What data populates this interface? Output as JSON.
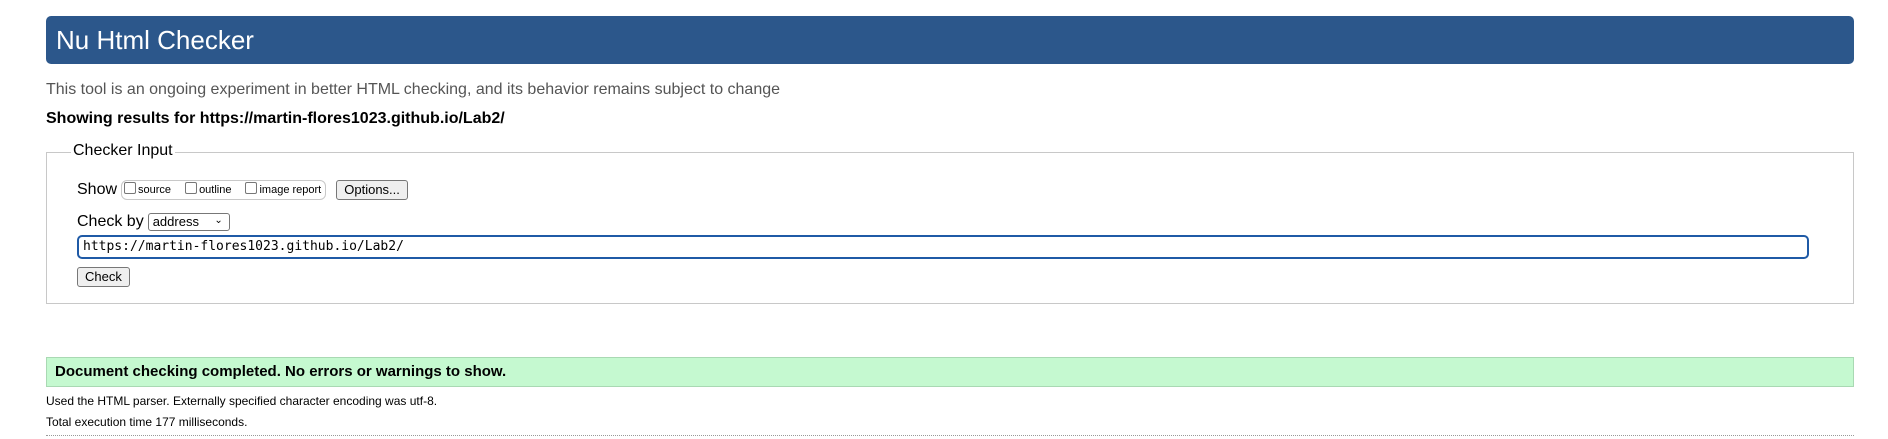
{
  "header": {
    "title": "Nu Html Checker"
  },
  "intro": "This tool is an ongoing experiment in better HTML checking, and its behavior remains subject to change",
  "results_for": "Showing results for https://martin-flores1023.github.io/Lab2/",
  "checker_input": {
    "legend": "Checker Input",
    "show_label": "Show",
    "checkboxes": [
      {
        "label": "source",
        "checked": false
      },
      {
        "label": "outline",
        "checked": false
      },
      {
        "label": "image report",
        "checked": false
      }
    ],
    "options_button": "Options...",
    "check_by_label": "Check by",
    "check_by_selected": "address",
    "url_value": "https://martin-flores1023.github.io/Lab2/",
    "check_button": "Check"
  },
  "result": {
    "message": "Document checking completed. No errors or warnings to show.",
    "parser_note": "Used the HTML parser. Externally specified character encoding was utf-8.",
    "time_note": "Total execution time 177 milliseconds."
  },
  "colors": {
    "header_bg": "#2c578b",
    "success_bg": "#c5f9d0",
    "input_focus": "#1f5aa6"
  }
}
